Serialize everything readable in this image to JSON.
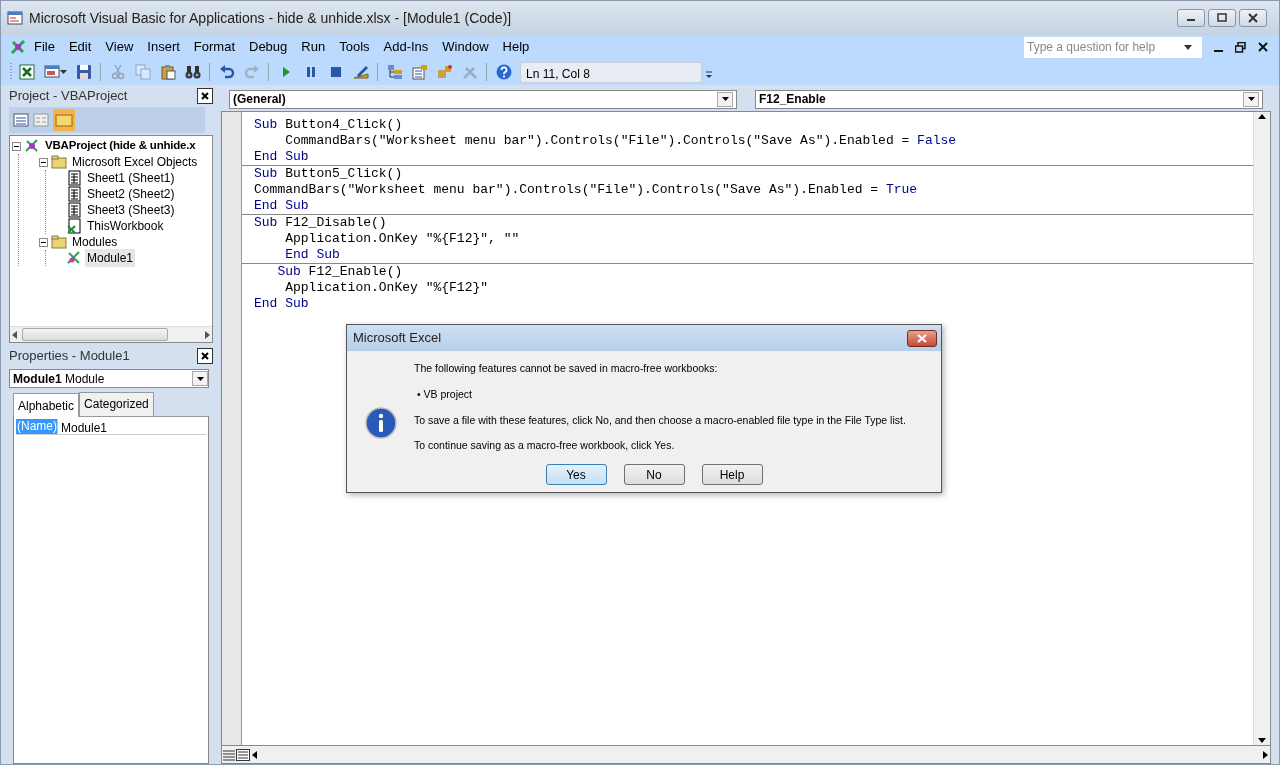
{
  "window": {
    "title": "Microsoft Visual Basic for Applications - hide & unhide.xlsx - [Module1 (Code)]"
  },
  "menu": [
    "File",
    "Edit",
    "View",
    "Insert",
    "Format",
    "Debug",
    "Run",
    "Tools",
    "Add-Ins",
    "Window",
    "Help"
  ],
  "help_search": {
    "placeholder": "Type a question for help"
  },
  "toolbar": {
    "buttons": [
      {
        "kind": "excel",
        "disabled": false
      },
      {
        "kind": "insert",
        "disabled": false
      },
      {
        "kind": "save",
        "disabled": false
      },
      {
        "kind": "separator"
      },
      {
        "kind": "cut",
        "disabled": true
      },
      {
        "kind": "copy",
        "disabled": true
      },
      {
        "kind": "paste",
        "disabled": false
      },
      {
        "kind": "find",
        "disabled": false
      },
      {
        "kind": "separator"
      },
      {
        "kind": "undo",
        "disabled": false
      },
      {
        "kind": "redo",
        "disabled": true
      },
      {
        "kind": "separator"
      },
      {
        "kind": "run",
        "disabled": false
      },
      {
        "kind": "break",
        "disabled": false
      },
      {
        "kind": "reset",
        "disabled": false
      },
      {
        "kind": "design",
        "disabled": false
      },
      {
        "kind": "separator"
      },
      {
        "kind": "explorer",
        "disabled": false
      },
      {
        "kind": "properties",
        "disabled": false
      },
      {
        "kind": "browser",
        "disabled": false
      },
      {
        "kind": "toolbox",
        "disabled": true
      },
      {
        "kind": "separator"
      },
      {
        "kind": "help",
        "disabled": false
      }
    ],
    "position": "Ln 11, Col 8"
  },
  "project_panel": {
    "title": "Project - VBAProject",
    "tree": [
      {
        "label": "VBAProject (hide & unhide.x",
        "kind": "project",
        "bold": true,
        "expanded": true,
        "selected": false,
        "children": [
          {
            "label": "Microsoft Excel Objects",
            "kind": "folder",
            "bold": false,
            "expanded": true,
            "selected": false,
            "children": [
              {
                "label": "Sheet1 (Sheet1)",
                "kind": "sheet",
                "bold": false,
                "selected": false
              },
              {
                "label": "Sheet2 (Sheet2)",
                "kind": "sheet",
                "bold": false,
                "selected": false
              },
              {
                "label": "Sheet3 (Sheet3)",
                "kind": "sheet",
                "bold": false,
                "selected": false
              },
              {
                "label": "ThisWorkbook",
                "kind": "workbook",
                "bold": false,
                "selected": false
              }
            ]
          },
          {
            "label": "Modules",
            "kind": "folder",
            "bold": false,
            "expanded": true,
            "selected": false,
            "children": [
              {
                "label": "Module1",
                "kind": "module",
                "bold": false,
                "selected": true
              }
            ]
          }
        ]
      }
    ]
  },
  "properties_panel": {
    "title": "Properties - Module1",
    "object": "**Module1** Module",
    "tabs": [
      {
        "label": "Alphabetic",
        "selected": true
      },
      {
        "label": "Categorized",
        "selected": false
      }
    ],
    "rows": [
      {
        "name": "(Name)",
        "value": "Module1",
        "selected": true
      }
    ]
  },
  "code_window": {
    "object_dropdown": "(General)",
    "procedure_dropdown": "F12_Enable",
    "procedures": [
      {
        "lines": [
          [
            {
              "kind": "keyword",
              "text": "Sub"
            },
            {
              "kind": "plain",
              "text": " Button4_Click()"
            }
          ],
          [
            {
              "kind": "plain",
              "text": "    CommandBars(\"Worksheet menu bar\").Controls(\"File\").Controls(\"Save As\").Enabled = "
            },
            {
              "kind": "keyword",
              "text": "False"
            }
          ],
          [
            {
              "kind": "keyword",
              "text": "End Sub"
            }
          ]
        ]
      },
      {
        "lines": [
          [
            {
              "kind": "keyword",
              "text": "Sub"
            },
            {
              "kind": "plain",
              "text": " Button5_Click()"
            }
          ],
          [
            {
              "kind": "plain",
              "text": "CommandBars(\"Worksheet menu bar\").Controls(\"File\").Controls(\"Save As\").Enabled = "
            },
            {
              "kind": "keyword",
              "text": "True"
            }
          ],
          [
            {
              "kind": "keyword",
              "text": "End Sub"
            }
          ]
        ]
      },
      {
        "lines": [
          [
            {
              "kind": "keyword",
              "text": "Sub"
            },
            {
              "kind": "plain",
              "text": " F12_Disable()"
            }
          ],
          [
            {
              "kind": "plain",
              "text": "    Application.OnKey \"%{F12}\", \"\""
            }
          ],
          [
            {
              "kind": "keyword",
              "text": "    End Sub"
            }
          ]
        ]
      },
      {
        "lines": [
          [
            {
              "kind": "keyword",
              "text": "   Sub"
            },
            {
              "kind": "plain",
              "text": " F12_Enable()"
            }
          ],
          [
            {
              "kind": "plain",
              "text": "    Application.OnKey \"%{F12}\""
            }
          ],
          [
            {
              "kind": "keyword",
              "text": "End Sub"
            }
          ]
        ]
      }
    ]
  },
  "dialog": {
    "title": "Microsoft Excel",
    "kind": "information",
    "paragraphs": [
      {
        "kind": "text",
        "text": "The following features cannot be saved in macro-free workbooks:"
      },
      {
        "kind": "bullet",
        "text": "• VB project"
      },
      {
        "kind": "text",
        "text": "To save a file with these features, click No, and then choose a macro-enabled file type in the File Type list."
      },
      {
        "kind": "text",
        "text": "To continue saving as a macro-free workbook, click Yes."
      }
    ],
    "buttons": [
      {
        "label": "Yes",
        "default": true
      },
      {
        "label": "No",
        "default": false
      },
      {
        "label": "Help",
        "default": false
      }
    ]
  }
}
